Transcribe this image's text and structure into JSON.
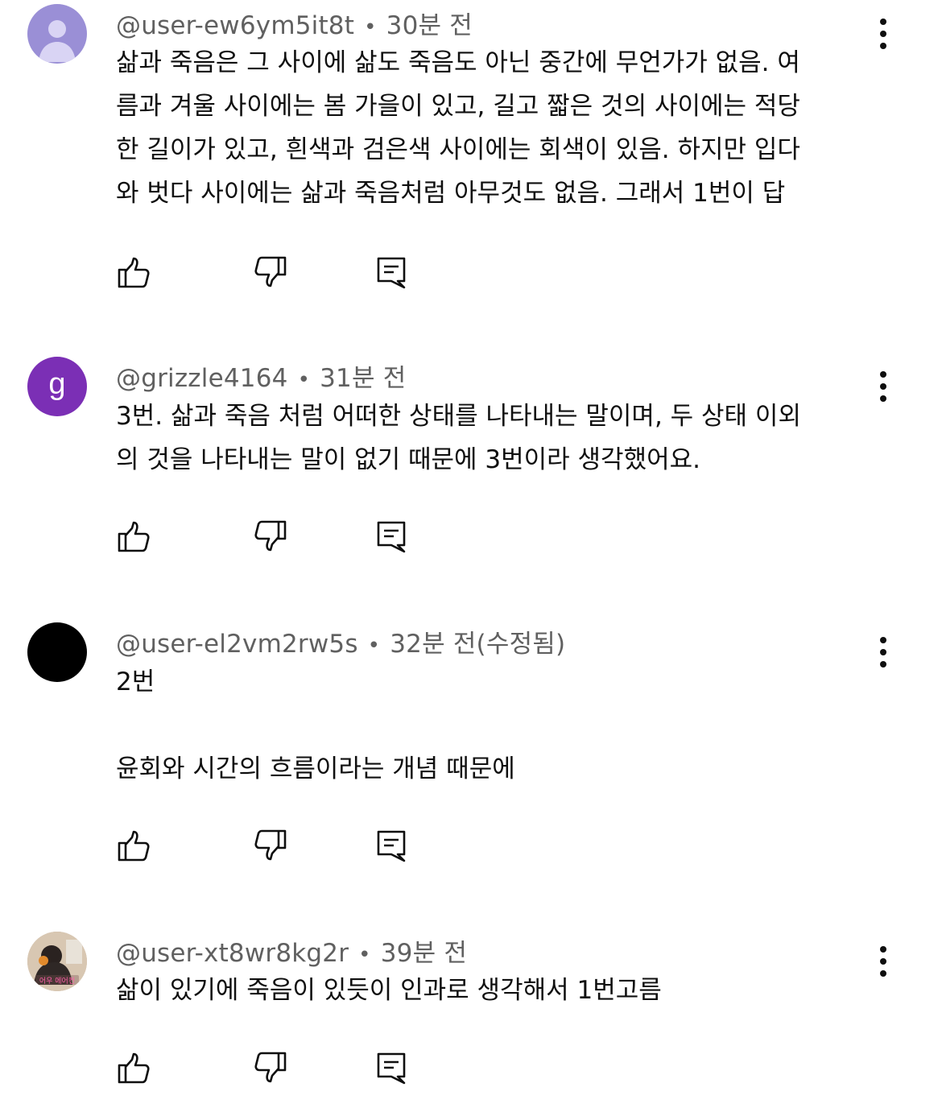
{
  "comments": [
    {
      "handle": "@user-ew6ym5it8t",
      "time": "30분 전",
      "avatar": {
        "type": "person",
        "bg": "#9a8fd6",
        "fg": "#d9d4f4"
      },
      "text": "삶과 죽음은 그 사이에 삶도 죽음도 아닌 중간에 무언가가 없음. 여\n름과 겨울 사이에는 봄 가을이 있고, 길고 짧은 것의 사이에는 적당\n한 길이가 있고, 흰색과 검은색 사이에는 회색이 있음. 하지만 입다\n와 벗다 사이에는 삶과 죽음처럼 아무것도 없음. 그래서 1번이 답"
    },
    {
      "handle": "@grizzle4164",
      "time": "31분 전",
      "avatar": {
        "type": "letter",
        "letter": "g",
        "bg": "#7b2fb5",
        "fg": "#ffffff"
      },
      "text": "3번. 삶과 죽음 처럼 어떠한 상태를 나타내는 말이며, 두 상태 이외\n의 것을 나타내는 말이 없기 때문에 3번이라 생각했어요."
    },
    {
      "handle": "@user-el2vm2rw5s",
      "time": "32분 전(수정됨)",
      "avatar": {
        "type": "solid",
        "bg": "#000000"
      },
      "text": "2번\n\n윤회와 시간의 흐름이라는 개념 때문에"
    },
    {
      "handle": "@user-xt8wr8kg2r",
      "time": "39분 전",
      "avatar": {
        "type": "photo",
        "bg": "#b89a80",
        "caption": "어우 에어컨"
      },
      "text": "삶이 있기에 죽음이 있듯이 인과로 생각해서 1번고름"
    }
  ],
  "separator": "•",
  "icons": [
    "like-icon",
    "dislike-icon",
    "reply-icon",
    "more-vert-icon"
  ]
}
